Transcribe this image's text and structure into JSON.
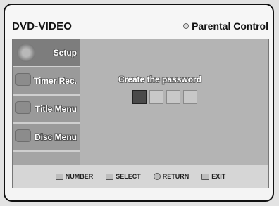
{
  "title_bar": {
    "source": "DVD-VIDEO",
    "section": "Parental Control",
    "section_icon": "settings-icon"
  },
  "sidebar": {
    "items": [
      {
        "label": "Setup",
        "icon": "setup-icon",
        "active": true
      },
      {
        "label": "Timer Rec.",
        "icon": "timer-icon",
        "active": false
      },
      {
        "label": "Title Menu",
        "icon": "title-menu-icon",
        "active": false
      },
      {
        "label": "Disc Menu",
        "icon": "disc-menu-icon",
        "active": false
      }
    ]
  },
  "main": {
    "prompt": "Create the password",
    "password": {
      "digits": 4,
      "focused_index": 0
    }
  },
  "help_bar": {
    "number": "NUMBER",
    "select": "SELECT",
    "return": "RETURN",
    "exit": "EXIT"
  }
}
